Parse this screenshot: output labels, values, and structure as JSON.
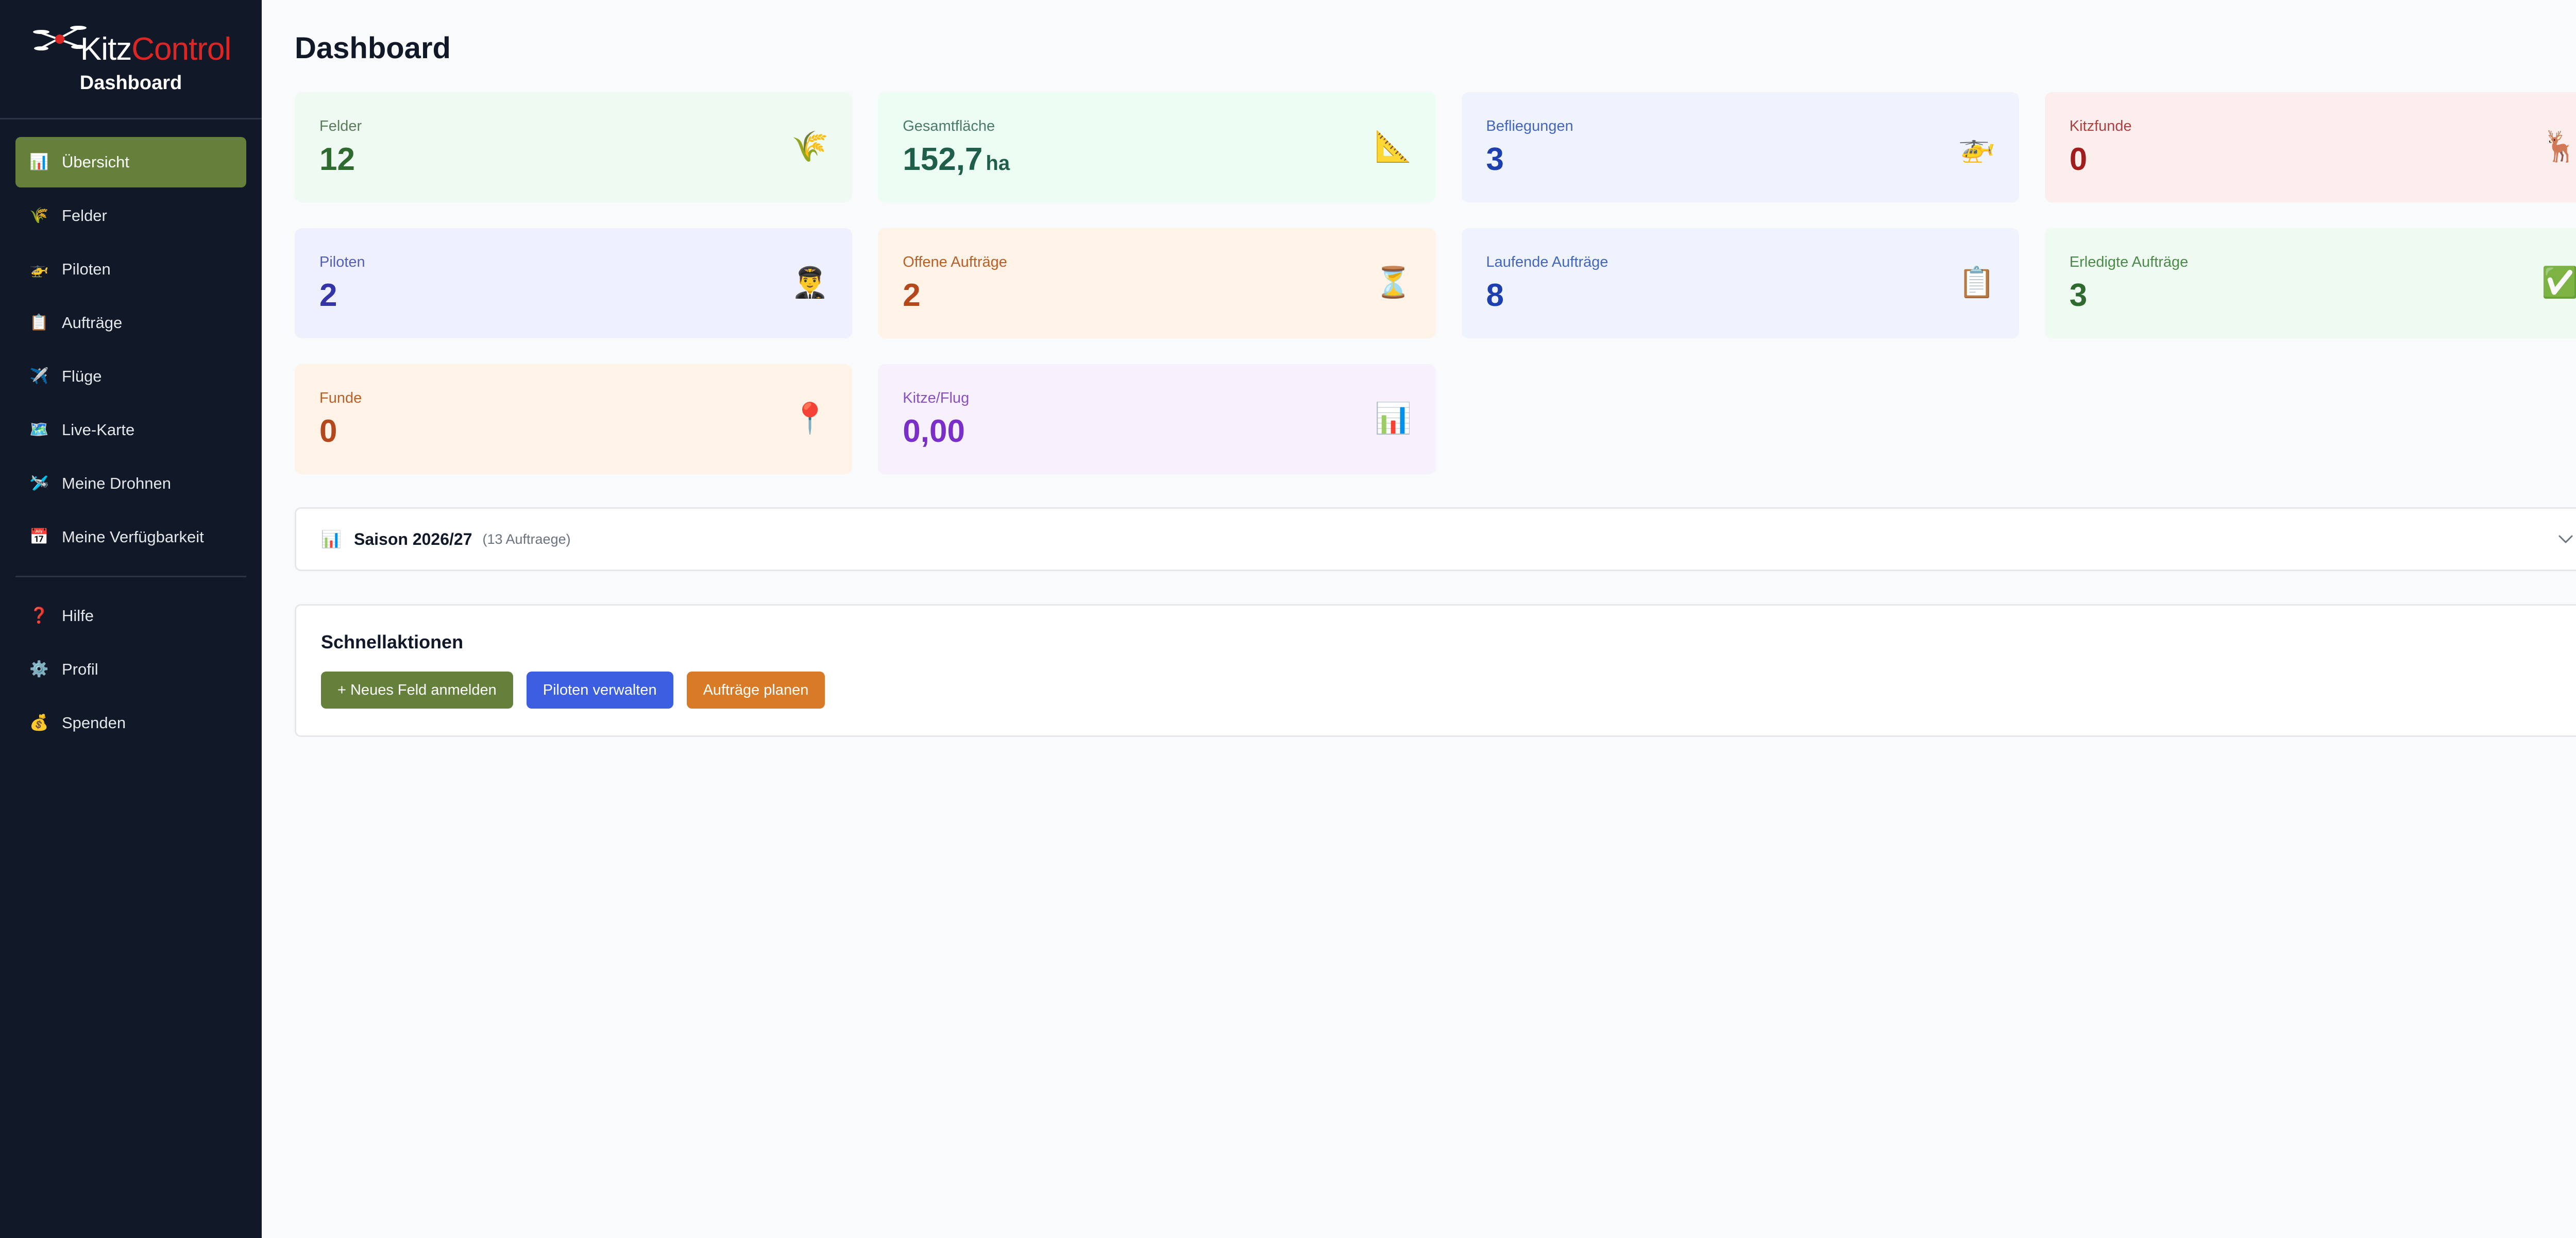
{
  "brand": {
    "logo_part1": "Kitz",
    "logo_part2": "Control",
    "subtitle": "Dashboard",
    "colors": {
      "kitz": "#ffffff",
      "control": "#dc2626"
    }
  },
  "sidebar": {
    "items": [
      {
        "label": "Übersicht",
        "icon": "bar-chart-icon",
        "active": true
      },
      {
        "label": "Felder",
        "icon": "wheat-icon"
      },
      {
        "label": "Piloten",
        "icon": "helicopter-icon"
      },
      {
        "label": "Aufträge",
        "icon": "clipboard-icon"
      },
      {
        "label": "Flüge",
        "icon": "airplane-icon"
      },
      {
        "label": "Live-Karte",
        "icon": "map-icon"
      },
      {
        "label": "Meine Drohnen",
        "icon": "drone-icon"
      },
      {
        "label": "Meine Verfügbarkeit",
        "icon": "calendar-icon"
      }
    ],
    "secondary": [
      {
        "label": "Hilfe",
        "icon": "question-icon"
      },
      {
        "label": "Profil",
        "icon": "gear-icon"
      },
      {
        "label": "Spenden",
        "icon": "money-bag-icon"
      }
    ],
    "active_color": "#65803a"
  },
  "page": {
    "title": "Dashboard"
  },
  "stats": [
    {
      "label": "Felder",
      "value": "12",
      "icon": "wheat-icon"
    },
    {
      "label": "Gesamtfläche",
      "value": "152,7",
      "unit": "ha",
      "icon": "triangle-ruler-icon"
    },
    {
      "label": "Befliegungen",
      "value": "3",
      "icon": "helicopter-icon"
    },
    {
      "label": "Kitzfunde",
      "value": "0",
      "icon": "deer-icon"
    },
    {
      "label": "Piloten",
      "value": "2",
      "icon": "pilot-icon"
    },
    {
      "label": "Offene Aufträge",
      "value": "2",
      "icon": "hourglass-icon"
    },
    {
      "label": "Laufende Aufträge",
      "value": "8",
      "icon": "clipboard-icon"
    },
    {
      "label": "Erledigte Aufträge",
      "value": "3",
      "icon": "check-icon"
    },
    {
      "label": "Funde",
      "value": "0",
      "icon": "pin-icon"
    },
    {
      "label": "Kitze/Flug",
      "value": "0,00",
      "icon": "bar-chart-icon"
    }
  ],
  "season": {
    "title": "Saison 2026/27",
    "count": "(13 Auftraege)",
    "icon": "bar-chart-icon"
  },
  "quick_actions": {
    "title": "Schnellaktionen",
    "buttons": [
      {
        "label": "+ Neues Feld anmelden",
        "color": "#65803a"
      },
      {
        "label": "Piloten verwalten",
        "color": "#3b5fe0"
      },
      {
        "label": "Aufträge planen",
        "color": "#d97a26"
      }
    ]
  }
}
